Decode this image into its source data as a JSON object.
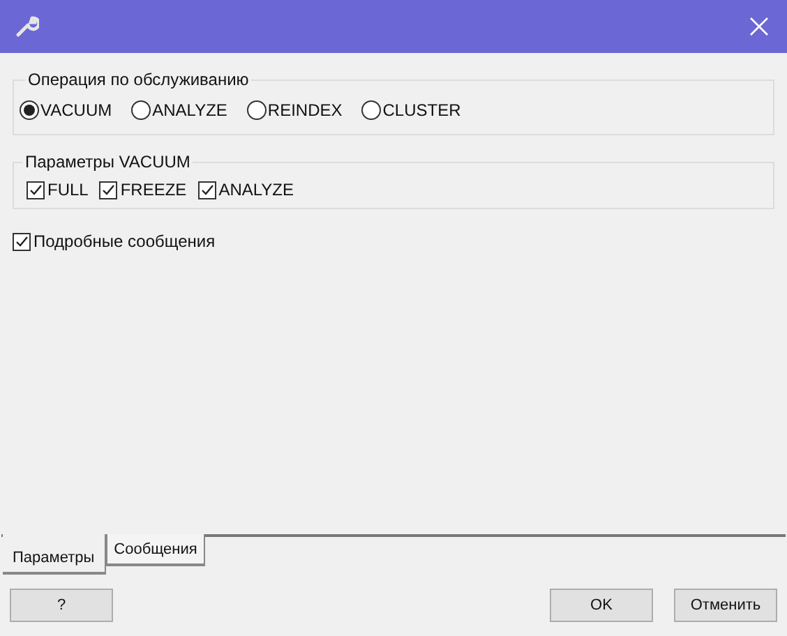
{
  "operation_group": {
    "title": "Операция по обслуживанию",
    "options": [
      {
        "label": "VACUUM",
        "selected": true
      },
      {
        "label": "ANALYZE",
        "selected": false
      },
      {
        "label": "REINDEX",
        "selected": false
      },
      {
        "label": "CLUSTER",
        "selected": false
      }
    ]
  },
  "vacuum_group": {
    "title": "Параметры VACUUM",
    "options": [
      {
        "label": "FULL",
        "checked": true
      },
      {
        "label": "FREEZE",
        "checked": true
      },
      {
        "label": "ANALYZE",
        "checked": true
      }
    ]
  },
  "verbose": {
    "label": "Подробные сообщения",
    "checked": true
  },
  "tabs": [
    {
      "label": "Параметры",
      "selected": true
    },
    {
      "label": "Сообщения",
      "selected": false
    }
  ],
  "buttons": {
    "help": "?",
    "ok": "OK",
    "cancel": "Отменить"
  }
}
